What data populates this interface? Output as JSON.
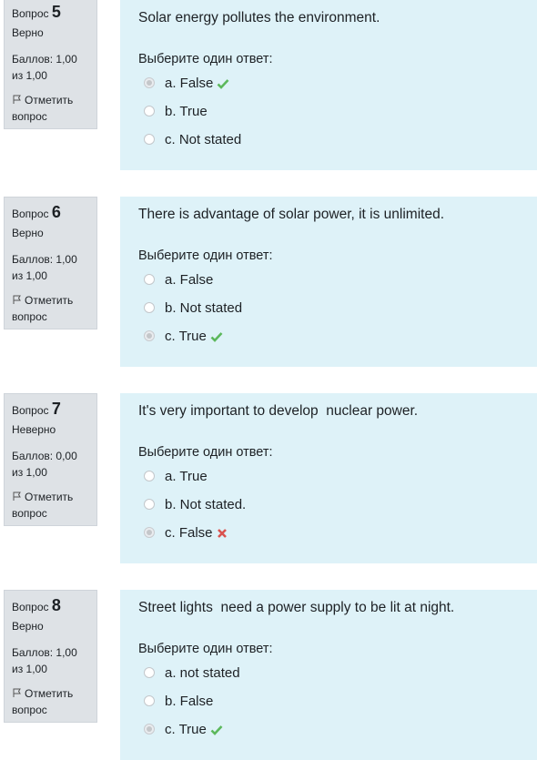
{
  "questions": [
    {
      "word": "Вопрос",
      "number": "5",
      "state": "Верно",
      "grade": "Баллов: 1,00 из 1,00",
      "flag": "Отметить вопрос",
      "text": "Solar energy pollutes the environment.",
      "prompt": "Выберите один ответ:",
      "answers": [
        {
          "label": "a. False",
          "checked": true,
          "mark": "check"
        },
        {
          "label": "b. True",
          "checked": false,
          "mark": ""
        },
        {
          "label": "c. Not stated",
          "checked": false,
          "mark": ""
        }
      ]
    },
    {
      "word": "Вопрос",
      "number": "6",
      "state": "Верно",
      "grade": "Баллов: 1,00 из 1,00",
      "flag": "Отметить вопрос",
      "text": "There is advantage of solar power, it is unlimited.",
      "prompt": "Выберите один ответ:",
      "answers": [
        {
          "label": "a. False",
          "checked": false,
          "mark": ""
        },
        {
          "label": "b. Not stated",
          "checked": false,
          "mark": ""
        },
        {
          "label": "c. True",
          "checked": true,
          "mark": "check"
        }
      ]
    },
    {
      "word": "Вопрос",
      "number": "7",
      "state": "Неверно",
      "grade": "Баллов: 0,00 из 1,00",
      "flag": "Отметить вопрос",
      "text": "It's very important to develop  nuclear power.",
      "prompt": "Выберите один ответ:",
      "answers": [
        {
          "label": "a. True",
          "checked": false,
          "mark": ""
        },
        {
          "label": "b. Not stated.",
          "checked": false,
          "mark": ""
        },
        {
          "label": "c. False",
          "checked": true,
          "mark": "cross"
        }
      ]
    },
    {
      "word": "Вопрос",
      "number": "8",
      "state": "Верно",
      "grade": "Баллов: 1,00 из 1,00",
      "flag": "Отметить вопрос",
      "text": "Street lights  need a power supply to be lit at night.",
      "prompt": "Выберите один ответ:",
      "answers": [
        {
          "label": "a. not stated",
          "checked": false,
          "mark": ""
        },
        {
          "label": "b. False",
          "checked": false,
          "mark": ""
        },
        {
          "label": "c. True",
          "checked": true,
          "mark": "check"
        }
      ]
    }
  ],
  "colors": {
    "info_bg": "#dee2e6",
    "content_bg": "#def2f8",
    "correct": "#5cb85c",
    "incorrect": "#d9534f"
  },
  "icons": {
    "flag": "flag-icon",
    "correct": "check-icon",
    "incorrect": "cross-icon"
  }
}
